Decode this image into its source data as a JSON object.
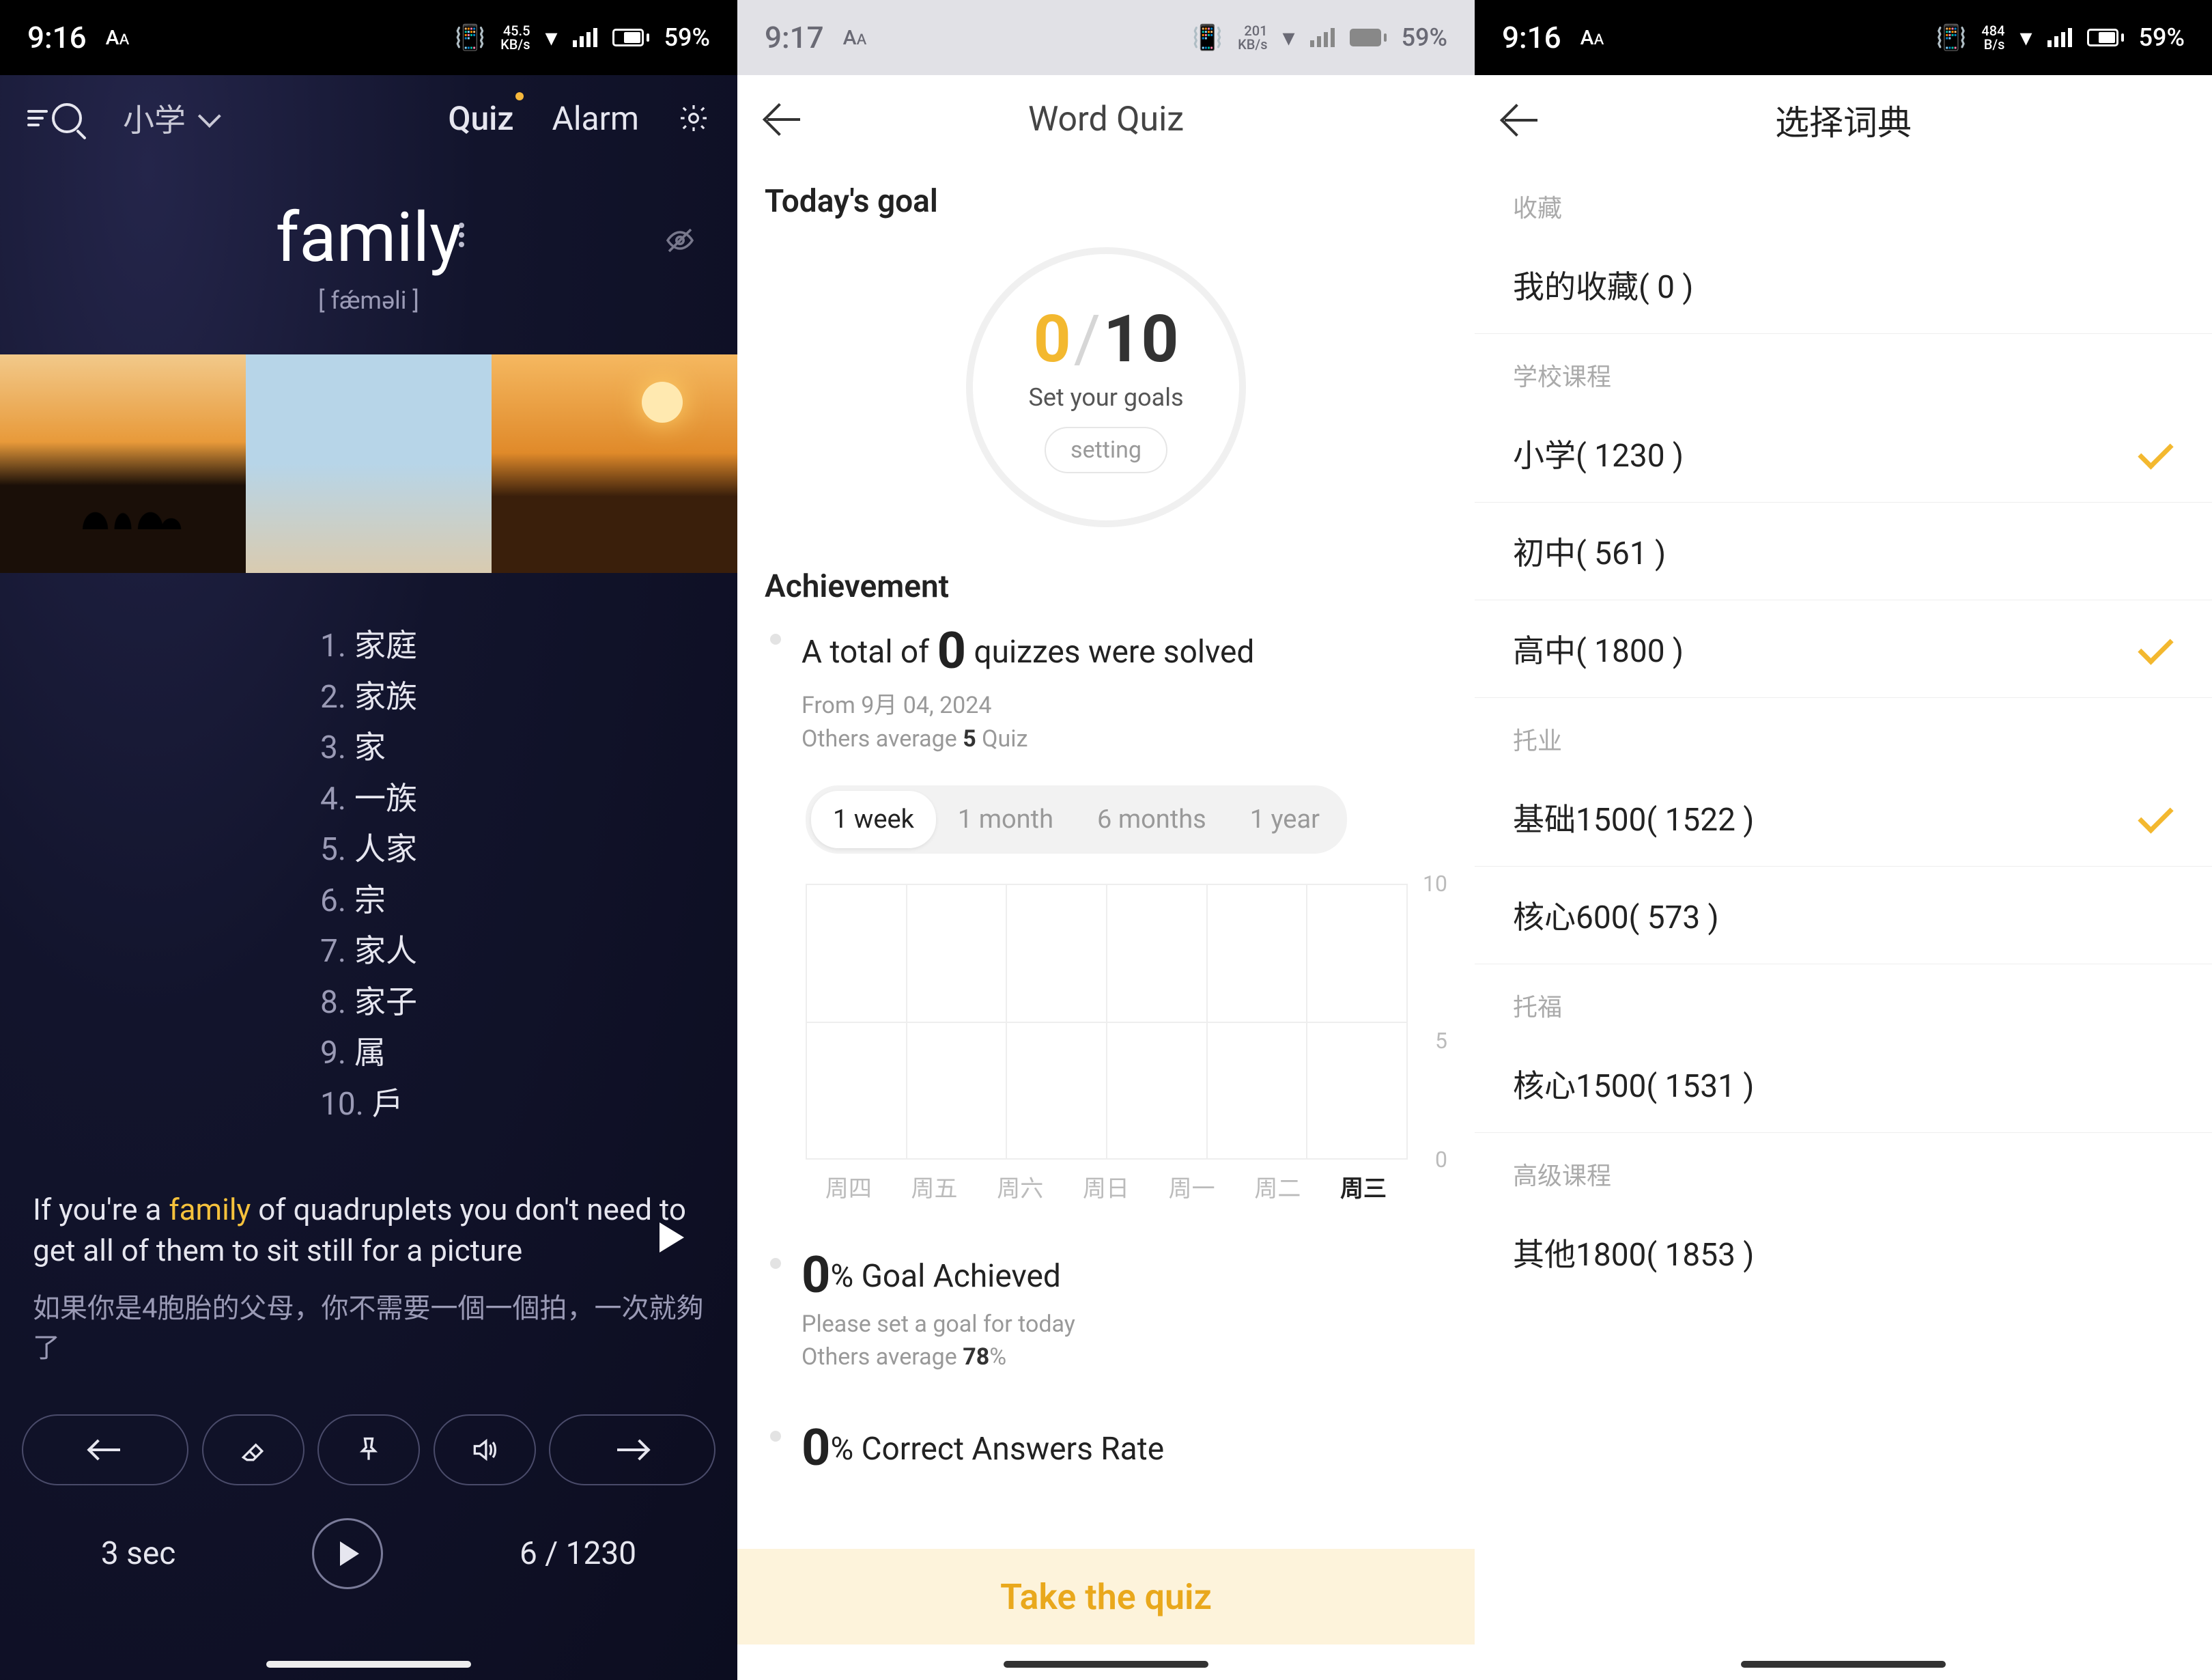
{
  "colors": {
    "accent": "#f3b82f",
    "text_dim": "#9a9ab5"
  },
  "status_left": {
    "time": "9:16",
    "aa": "Aᴀ",
    "net_rate": "45.5",
    "net_unit": "KB/s",
    "battery": "59%"
  },
  "status_mid": {
    "time": "9:17",
    "aa": "Aᴀ",
    "net_rate": "201",
    "net_unit": "KB/s",
    "battery": "59%"
  },
  "status_right": {
    "time": "9:16",
    "aa": "Aᴀ",
    "net_rate": "484",
    "net_unit": "B/s",
    "battery": "59%"
  },
  "home": {
    "level": "小学",
    "quiz_label": "Quiz",
    "alarm_label": "Alarm",
    "word": "family",
    "pron": "[ fǽməli ]",
    "defs": [
      {
        "n": "1.",
        "t": "家庭"
      },
      {
        "n": "2.",
        "t": "家族"
      },
      {
        "n": "3.",
        "t": "家"
      },
      {
        "n": "4.",
        "t": "一族"
      },
      {
        "n": "5.",
        "t": "人家"
      },
      {
        "n": "6.",
        "t": "宗"
      },
      {
        "n": "7.",
        "t": "家人"
      },
      {
        "n": "8.",
        "t": "家子"
      },
      {
        "n": "9.",
        "t": "属"
      },
      {
        "n": "10.",
        "t": "戶"
      }
    ],
    "example_en_pre": "If you're a ",
    "example_en_word": "family",
    "example_en_post": " of quadruplets you don't need to get all of them to sit still for a picture",
    "example_zh": "如果你是4胞胎的父母，你不需要一個一個拍，一次就夠了",
    "timer": "3 sec",
    "progress": "6 / 1230"
  },
  "quiz": {
    "page_title": "Word Quiz",
    "goal_heading": "Today's goal",
    "goal_done": "0",
    "goal_slash": "/",
    "goal_total": "10",
    "goal_sub": "Set your goals",
    "setting_label": "setting",
    "ach_heading": "Achievement",
    "ach1_pre": "A total of ",
    "ach1_big": "0",
    "ach1_post": " quizzes were solved",
    "ach1_sub1": "From 9月 04, 2024",
    "ach1_sub2_pre": "Others average ",
    "ach1_sub2_b": "5",
    "ach1_sub2_post": " Quiz",
    "ranges": [
      "1 week",
      "1 month",
      "6 months",
      "1 year"
    ],
    "range_active": 0,
    "ach2_big": "0",
    "ach2_post": "% Goal Achieved",
    "ach2_sub1": "Please set a goal for today",
    "ach2_sub2_pre": "Others average ",
    "ach2_sub2_b": "78",
    "ach2_sub2_post": "%",
    "ach3_big": "0",
    "ach3_post": "% Correct Answers Rate",
    "cta": "Take the quiz"
  },
  "chart_data": {
    "type": "bar",
    "title": "",
    "xlabel": "",
    "ylabel": "",
    "categories": [
      "周四",
      "周五",
      "周六",
      "周日",
      "周一",
      "周二",
      "周三"
    ],
    "values": [
      0,
      0,
      0,
      0,
      0,
      0,
      0
    ],
    "yticks": [
      0,
      5,
      10
    ],
    "ylim": [
      0,
      10
    ],
    "active_index": 6
  },
  "dict": {
    "page_title": "选择词典",
    "sections": [
      {
        "cat": "收藏",
        "rows": [
          {
            "label": "我的收藏( 0 )",
            "checked": false
          }
        ]
      },
      {
        "cat": "学校课程",
        "rows": [
          {
            "label": "小学( 1230 )",
            "checked": true
          },
          {
            "label": "初中( 561 )",
            "checked": false
          },
          {
            "label": "高中( 1800 )",
            "checked": true
          }
        ]
      },
      {
        "cat": "托业",
        "rows": [
          {
            "label": "基础1500( 1522 )",
            "checked": true
          },
          {
            "label": "核心600( 573 )",
            "checked": false
          }
        ]
      },
      {
        "cat": "托福",
        "rows": [
          {
            "label": "核心1500( 1531 )",
            "checked": false
          }
        ]
      },
      {
        "cat": "高级课程",
        "rows": [
          {
            "label": "其他1800( 1853 )",
            "checked": false
          }
        ]
      }
    ]
  }
}
